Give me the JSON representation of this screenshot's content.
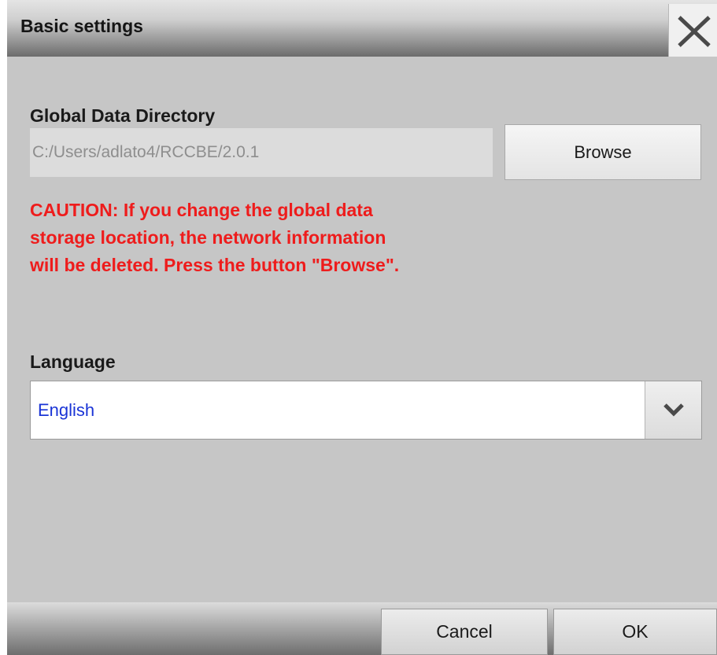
{
  "dialog": {
    "title": "Basic settings",
    "close_icon": "close-icon"
  },
  "global_data": {
    "label": "Global Data Directory",
    "path_value": "C:/Users/adlato4/RCCBE/2.0.1",
    "browse_label": "Browse",
    "caution_lines": [
      "CAUTION: If you change the global data",
      "storage location, the network information",
      "will be deleted. Press the button \"Browse\"."
    ]
  },
  "language": {
    "label": "Language",
    "selected": "English",
    "dropdown_icon": "chevron-down-icon"
  },
  "footer": {
    "cancel_label": "Cancel",
    "ok_label": "OK"
  },
  "colors": {
    "dialog_background": "#c6c6c6",
    "caution_text": "#ee1c1c",
    "selected_value_text": "#1a34d6"
  }
}
